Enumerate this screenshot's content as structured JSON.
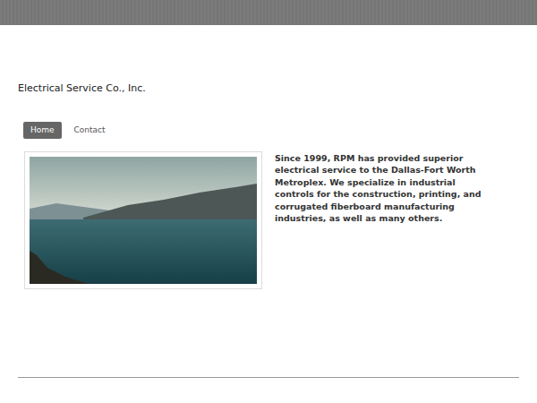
{
  "site": {
    "title": "Electrical Service Co., Inc."
  },
  "nav": [
    {
      "label": "Home",
      "selected": true
    },
    {
      "label": "Contact",
      "selected": false
    }
  ],
  "intro": "Since 1999, RPM has provided superior electrical service to the Dallas-Fort Worth Metroplex. We specialize in industrial controls for the construction, printing, and corrugated fiberboard manufacturing industries, as well as many others."
}
